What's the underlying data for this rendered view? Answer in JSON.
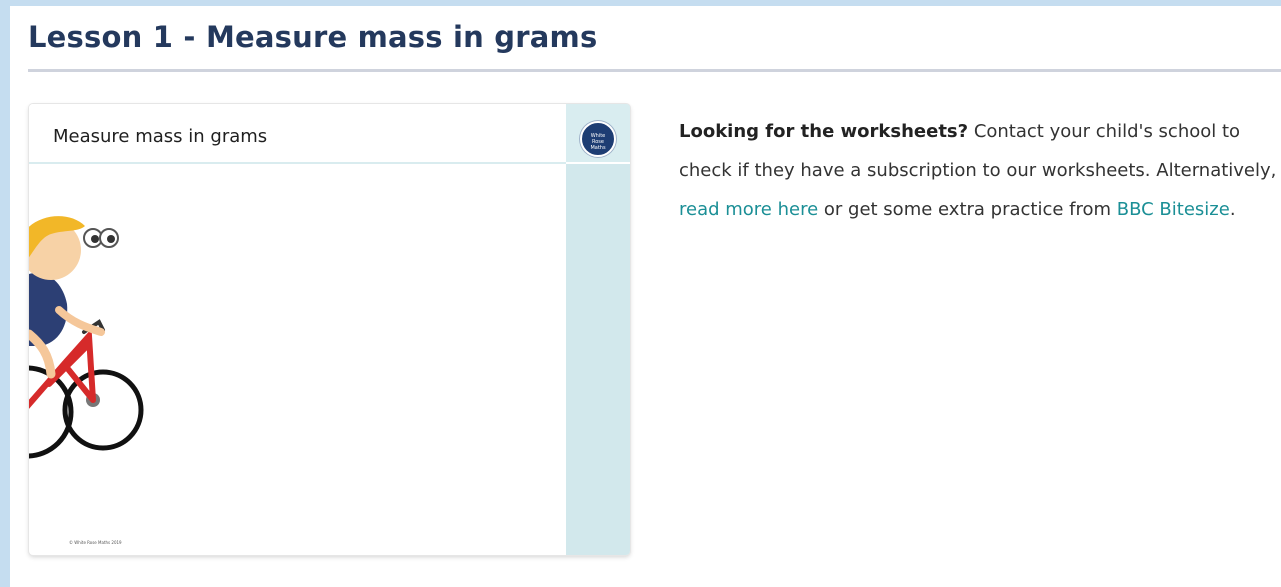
{
  "lesson": {
    "title": "Lesson 1 - Measure mass in grams"
  },
  "video_card": {
    "title": "Measure mass in grams",
    "logo_lines": [
      "White",
      "Rose",
      "Maths"
    ],
    "copyright": "© White Rose Maths 2019",
    "illustration_icon": "girl-on-bicycle-icon"
  },
  "info": {
    "bold_question": "Looking for the worksheets?",
    "text_1": " Contact your child's school to check if they have a subscription to our worksheets. Alternatively, ",
    "link_read_more": "read more here",
    "text_2": " or get some extra practice from ",
    "link_bbc": "BBC Bitesize",
    "text_3": "."
  },
  "colors": {
    "page_background": "#c5ddf0",
    "title_color": "#24395d",
    "link_color": "#1b8f96",
    "strip_color": "#d2e8ec"
  }
}
